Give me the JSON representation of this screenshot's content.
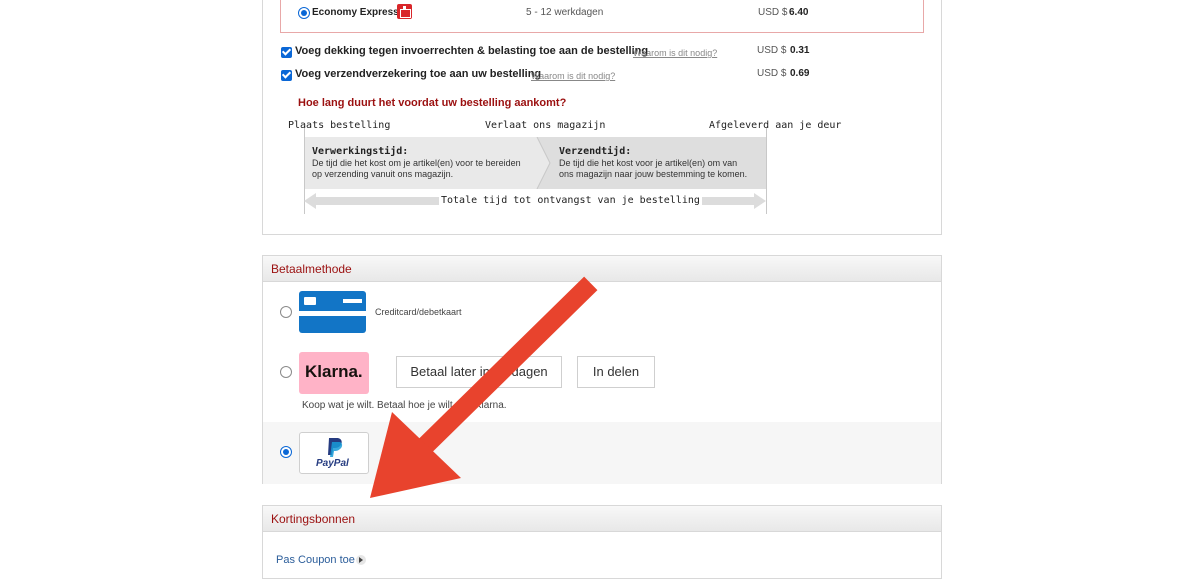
{
  "shipping": {
    "economy": {
      "name": "Economy Express",
      "duration": "5 - 12 werkdagen",
      "price_prefix": "USD $",
      "price": "6.40"
    },
    "duty_option": {
      "label": "Voeg dekking tegen invoerrechten & belasting toe aan de bestelling",
      "why": "Waarom is dit nodig?",
      "price_prefix": "USD $",
      "price": "0.31"
    },
    "insurance_option": {
      "label": "Voeg verzendverzekering toe aan uw bestelling",
      "why": "Waarom is dit nodig?",
      "price_prefix": "USD $",
      "price": "0.69"
    },
    "delivery_question": "Hoe lang duurt het voordat uw bestelling aankomt?",
    "timeline": {
      "step1": "Plaats bestelling",
      "step2": "Verlaat ons magazijn",
      "step3": "Afgeleverd aan je deur",
      "processing_title": "Verwerkingstijd:",
      "processing_desc_1": "De tijd die het kost om je artikel(en) voor te bereiden",
      "processing_desc_2": "op verzending vanuit ons magazijn.",
      "shipping_title": "Verzendtijd:",
      "shipping_desc_1": "De tijd die het kost voor je artikel(en) om van",
      "shipping_desc_2": "ons magazijn naar jouw bestemming te komen.",
      "total": "Totale tijd tot ontvangst van je bestelling"
    }
  },
  "payment": {
    "heading": "Betaalmethode",
    "card_label": "Creditcard/debetkaart",
    "klarna_logo": "Klarna.",
    "klarna_pay_later": "Betaal later in 30 dagen",
    "klarna_installments": "In delen",
    "klarna_tagline": "Koop wat je wilt. Betaal hoe je wilt met Klarna.",
    "paypal_logo": "PayPal"
  },
  "coupons": {
    "heading": "Kortingsbonnen",
    "add_coupon": "Pas Coupon toe"
  },
  "colors": {
    "accent_red": "#9b1010",
    "arrow_red": "#e8432d",
    "checkbox_blue": "#0a67d6",
    "card_blue": "#1275c6",
    "klarna_pink": "#ffb3c7",
    "paypal_navy": "#253b80",
    "paypal_light": "#179bd7"
  },
  "icons": {
    "gift": "gift-icon",
    "chevron": "chevron-right-icon",
    "card": "credit-card-icon",
    "arrow": "annotation-arrow"
  }
}
